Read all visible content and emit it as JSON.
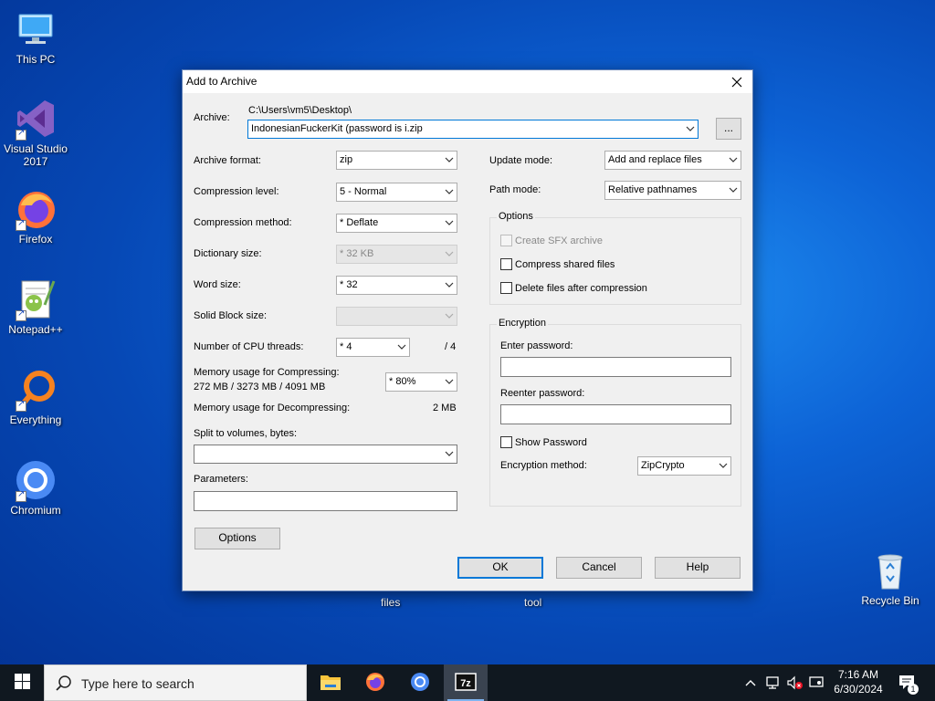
{
  "desktop": {
    "icons": [
      {
        "label": "This PC"
      },
      {
        "label": "Visual Studio 2017"
      },
      {
        "label": "Firefox"
      },
      {
        "label": "Notepad++"
      },
      {
        "label": "Everything"
      },
      {
        "label": "Chromium"
      },
      {
        "label": "Recycle Bin"
      }
    ],
    "floating_labels": [
      "files",
      "tool"
    ]
  },
  "dialog": {
    "title": "Add to Archive",
    "archive": {
      "label": "Archive:",
      "path": "C:\\Users\\vm5\\Desktop\\",
      "value": "IndonesianFuckerKit (password is i.zip",
      "browse_label": "..."
    },
    "left": {
      "archive_format": {
        "label": "Archive format:",
        "value": "zip"
      },
      "compression_level": {
        "label": "Compression level:",
        "value": "5 - Normal"
      },
      "compression_method": {
        "label": "Compression method:",
        "value": "*  Deflate"
      },
      "dictionary_size": {
        "label": "Dictionary size:",
        "value": "*  32 KB"
      },
      "word_size": {
        "label": "Word size:",
        "value": "*  32"
      },
      "solid_block": {
        "label": "Solid Block size:",
        "value": ""
      },
      "cpu_threads": {
        "label": "Number of CPU threads:",
        "value": "*  4",
        "max": "/ 4"
      },
      "mem_compress": {
        "label": "Memory usage for Compressing:",
        "detail": "272 MB / 3273 MB / 4091 MB",
        "value": "*  80%"
      },
      "mem_decompress": {
        "label": "Memory usage for Decompressing:",
        "value": "2 MB"
      },
      "split": {
        "label": "Split to volumes, bytes:",
        "value": ""
      },
      "parameters": {
        "label": "Parameters:",
        "value": ""
      },
      "options_button": "Options"
    },
    "right": {
      "update_mode": {
        "label": "Update mode:",
        "value": "Add and replace files"
      },
      "path_mode": {
        "label": "Path mode:",
        "value": "Relative pathnames"
      },
      "options_group": {
        "label": "Options",
        "create_sfx": "Create SFX archive",
        "compress_shared": "Compress shared files",
        "delete_after": "Delete files after compression"
      },
      "encryption_group": {
        "label": "Encryption",
        "enter_password": "Enter password:",
        "reenter_password": "Reenter password:",
        "show_password": "Show Password",
        "method_label": "Encryption method:",
        "method_value": "ZipCrypto"
      }
    },
    "buttons": {
      "ok": "OK",
      "cancel": "Cancel",
      "help": "Help"
    }
  },
  "taskbar": {
    "search_placeholder": "Type here to search",
    "time": "7:16 AM",
    "date": "6/30/2024",
    "notification_count": "1"
  },
  "colors": {
    "accent": "#0078d7",
    "desktop": "#0a5bd0",
    "taskbar": "#101820"
  }
}
